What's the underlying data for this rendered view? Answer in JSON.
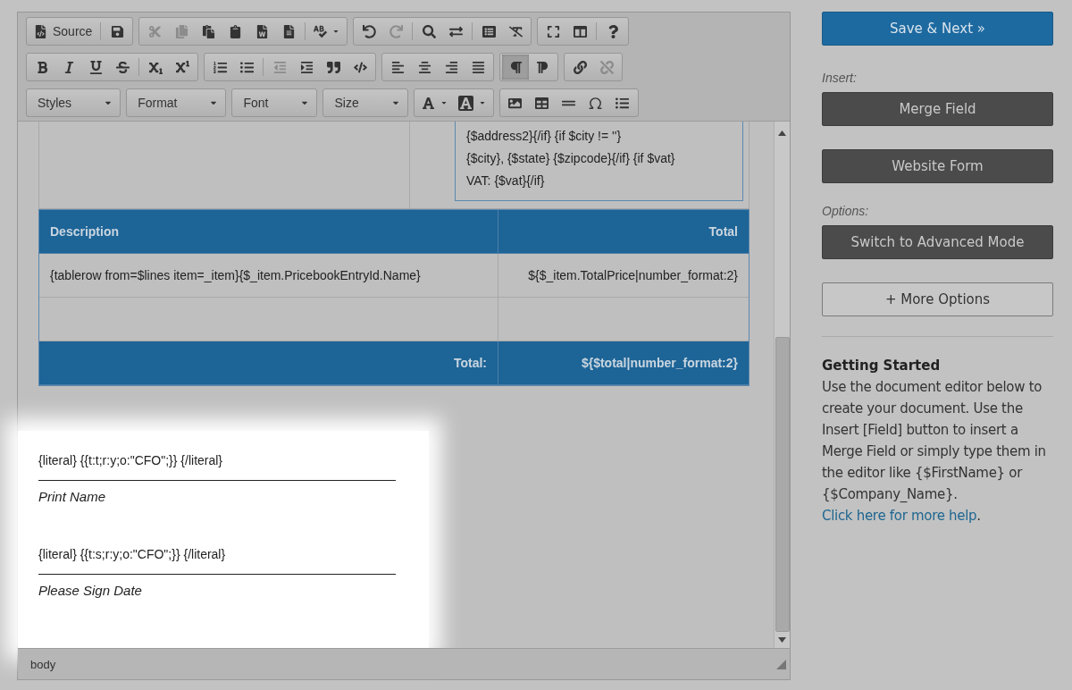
{
  "toolbar": {
    "rows": [
      [
        {
          "items": [
            {
              "kind": "source",
              "label": "Source",
              "disabled": false
            },
            {
              "kind": "sep"
            },
            {
              "kind": "save",
              "disabled": false
            }
          ]
        },
        {
          "items": [
            {
              "kind": "cut",
              "disabled": true
            },
            {
              "kind": "copy",
              "disabled": true
            },
            {
              "kind": "paste",
              "disabled": false
            },
            {
              "kind": "paste-text",
              "disabled": false
            },
            {
              "kind": "paste-word",
              "disabled": false
            },
            {
              "kind": "templates",
              "disabled": false
            },
            {
              "kind": "sep"
            },
            {
              "kind": "spellcheck",
              "disabled": false
            }
          ]
        },
        {
          "items": [
            {
              "kind": "undo",
              "disabled": false
            },
            {
              "kind": "redo",
              "disabled": true
            },
            {
              "kind": "sep"
            },
            {
              "kind": "find",
              "disabled": false
            },
            {
              "kind": "replace",
              "disabled": false
            },
            {
              "kind": "sep"
            },
            {
              "kind": "select-all",
              "disabled": false
            },
            {
              "kind": "remove-format",
              "disabled": false
            }
          ]
        },
        {
          "items": [
            {
              "kind": "maximize",
              "disabled": false
            },
            {
              "kind": "show-blocks",
              "disabled": false
            },
            {
              "kind": "sep"
            },
            {
              "kind": "help",
              "disabled": false
            }
          ]
        }
      ],
      [
        {
          "items": [
            {
              "kind": "bold",
              "disabled": false
            },
            {
              "kind": "italic",
              "disabled": false
            },
            {
              "kind": "underline",
              "disabled": false
            },
            {
              "kind": "strike",
              "disabled": false
            },
            {
              "kind": "sep"
            },
            {
              "kind": "subscript",
              "disabled": false
            },
            {
              "kind": "superscript",
              "disabled": false
            }
          ]
        },
        {
          "items": [
            {
              "kind": "numbered-list",
              "disabled": false
            },
            {
              "kind": "bulleted-list",
              "disabled": false
            },
            {
              "kind": "sep"
            },
            {
              "kind": "outdent",
              "disabled": true
            },
            {
              "kind": "indent",
              "disabled": false
            },
            {
              "kind": "blockquote",
              "disabled": false
            },
            {
              "kind": "div",
              "disabled": false
            }
          ]
        },
        {
          "items": [
            {
              "kind": "align-left",
              "disabled": false
            },
            {
              "kind": "align-center",
              "disabled": false
            },
            {
              "kind": "align-right",
              "disabled": false
            },
            {
              "kind": "justify",
              "disabled": false
            }
          ]
        },
        {
          "items": [
            {
              "kind": "ltr",
              "disabled": false,
              "selected": true
            },
            {
              "kind": "rtl",
              "disabled": false,
              "selected": false
            }
          ]
        },
        {
          "items": [
            {
              "kind": "link",
              "disabled": false
            },
            {
              "kind": "unlink",
              "disabled": true
            }
          ]
        }
      ],
      [
        {
          "items": [
            {
              "kind": "combo",
              "label": "Styles"
            }
          ]
        },
        {
          "items": [
            {
              "kind": "combo",
              "label": "Format"
            }
          ]
        },
        {
          "items": [
            {
              "kind": "combo",
              "label": "Font"
            }
          ]
        },
        {
          "items": [
            {
              "kind": "combo",
              "label": "Size"
            }
          ]
        },
        {
          "items": [
            {
              "kind": "text-color",
              "disabled": false
            },
            {
              "kind": "bg-color",
              "disabled": false
            }
          ]
        },
        {
          "items": [
            {
              "kind": "image",
              "disabled": false
            },
            {
              "kind": "table",
              "disabled": false
            },
            {
              "kind": "page-break",
              "disabled": false
            },
            {
              "kind": "special-char",
              "disabled": false
            },
            {
              "kind": "insert-field",
              "disabled": false
            }
          ]
        }
      ]
    ]
  },
  "document": {
    "address_lines": [
      "{$address2}{/if} {if $city != ''}",
      "{$city}, {$state} {$zipcode}{/if} {if $vat}",
      "VAT: {$vat}{/if}"
    ],
    "table": {
      "columns": [
        "Description",
        "Total"
      ],
      "rows": [
        [
          "{tablerow from=$lines item=_item}{$_item.PricebookEntryId.Name}",
          "${$_item.TotalPrice|number_format:2}"
        ],
        [
          "",
          ""
        ]
      ],
      "footer": [
        "Total:",
        "${$total|number_format:2}"
      ]
    },
    "signatures": [
      {
        "tag": "{literal} {{t:t;r:y;o:\"CFO\";}} {/literal}",
        "caption": "Print Name"
      },
      {
        "tag": "{literal} {{t:s;r:y;o:\"CFO\";}} {/literal}",
        "caption": "Please Sign Date"
      }
    ]
  },
  "status_bar": {
    "path": "body"
  },
  "sidebar": {
    "primary_button": "Save & Next »",
    "sections": [
      {
        "label": "Insert:",
        "buttons": [
          {
            "label": "Merge Field",
            "kind": "dark"
          },
          {
            "label": "Website Form",
            "kind": "dark"
          }
        ]
      },
      {
        "label": "Options:",
        "buttons": [
          {
            "label": "Switch to Advanced Mode",
            "kind": "dark"
          },
          {
            "label": "+ More Options",
            "kind": "outline"
          }
        ]
      }
    ],
    "help": {
      "title": "Getting Started",
      "text": "Use the document editor below to create your document. Use the Insert [Field] button to insert a Merge Field or simply type them in the editor like {$FirstName} or {$Company_Name}.",
      "link": "Click here for more help",
      "after": "."
    }
  }
}
